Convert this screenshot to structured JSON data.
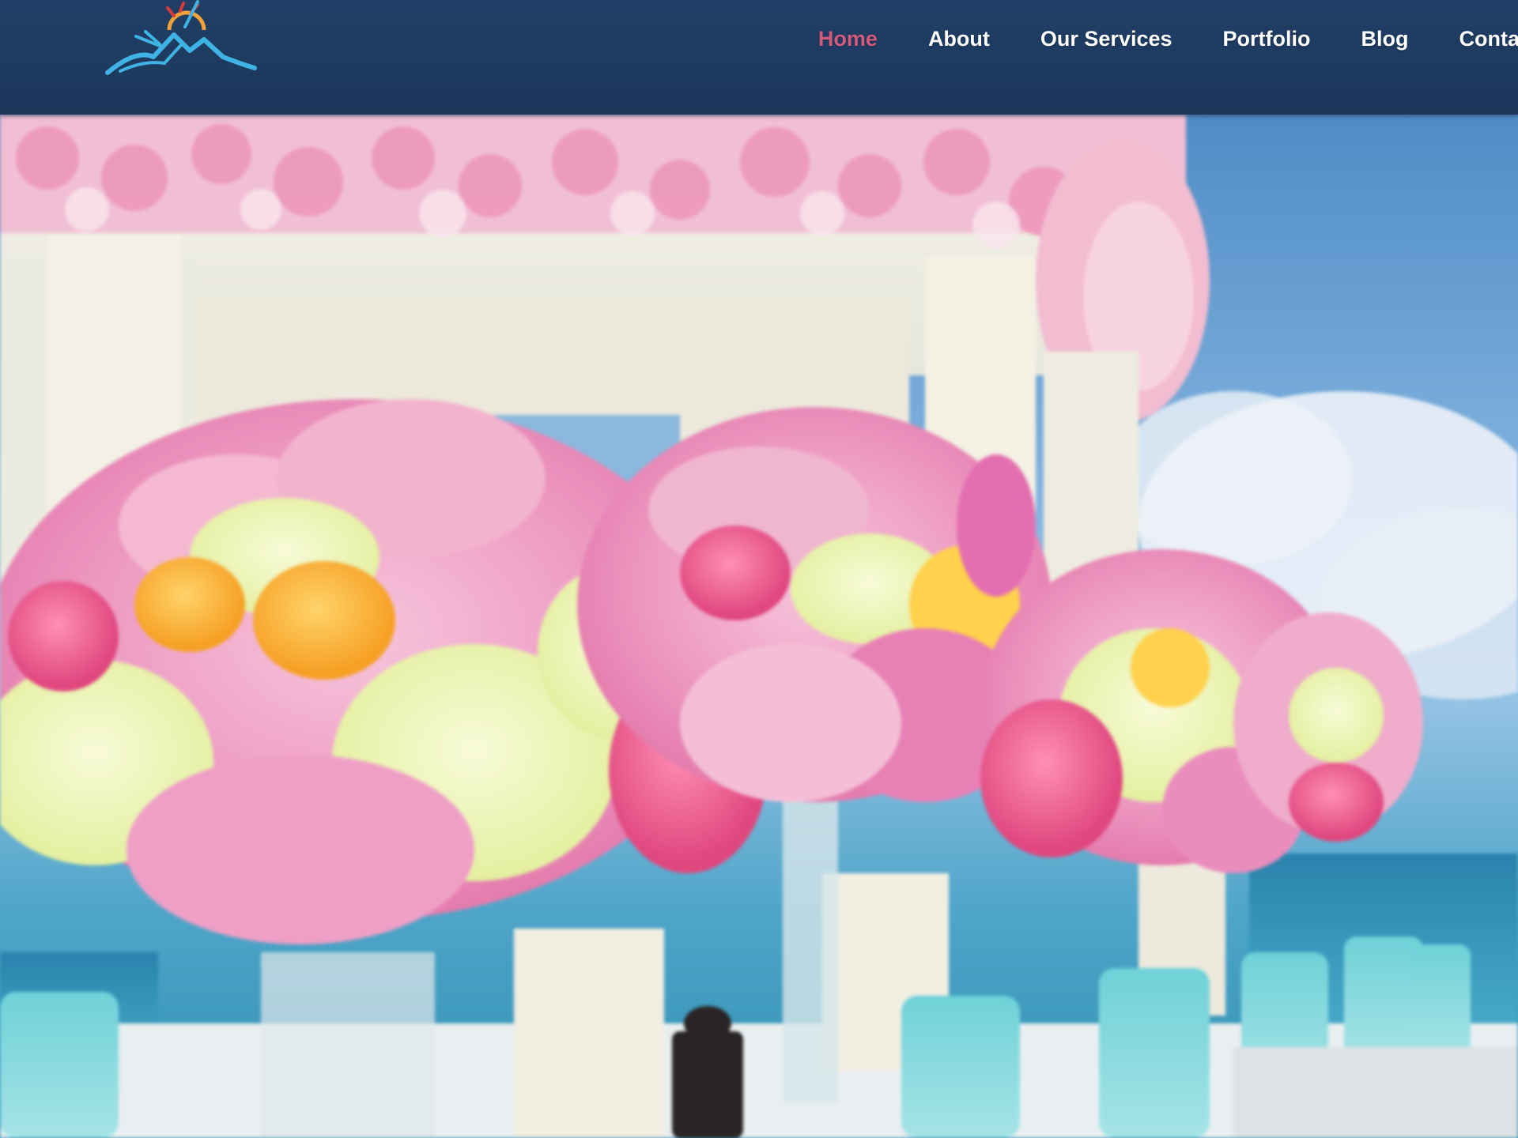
{
  "site": {
    "logo_icon": "mountain-sun-logo-icon"
  },
  "nav": {
    "items": [
      {
        "label": "Home",
        "active": true
      },
      {
        "label": "About",
        "active": false
      },
      {
        "label": "Our Services",
        "active": false
      },
      {
        "label": "Portfolio",
        "active": false
      },
      {
        "label": "Blog",
        "active": false
      },
      {
        "label": "Contact",
        "active": false
      }
    ]
  },
  "colors": {
    "header_bg": "#1d3a5f",
    "nav_text": "#ffffff",
    "nav_active": "#d35a7d",
    "logo_blue": "#3fb4e4",
    "logo_sun": "#f0a23a"
  },
  "hero": {
    "image_icon": "wedding-flower-arrangement-hero-image"
  }
}
